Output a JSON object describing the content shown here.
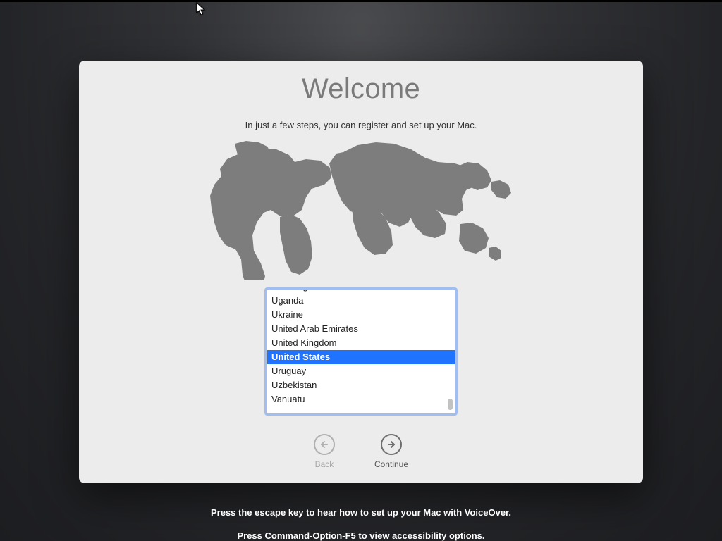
{
  "header": {
    "title": "Welcome",
    "subtitle": "In just a few steps, you can register and set up your Mac."
  },
  "countries": {
    "visible": [
      "U.S. Virgin Islands",
      "Uganda",
      "Ukraine",
      "United Arab Emirates",
      "United Kingdom",
      "United States",
      "Uruguay",
      "Uzbekistan",
      "Vanuatu"
    ],
    "selected_index": 5
  },
  "nav": {
    "back": {
      "label": "Back",
      "enabled": false
    },
    "continue": {
      "label": "Continue",
      "enabled": true
    }
  },
  "hints": {
    "voiceover": "Press the escape key to hear how to set up your Mac with VoiceOver.",
    "accessibility": "Press Command-Option-F5 to view accessibility options."
  }
}
